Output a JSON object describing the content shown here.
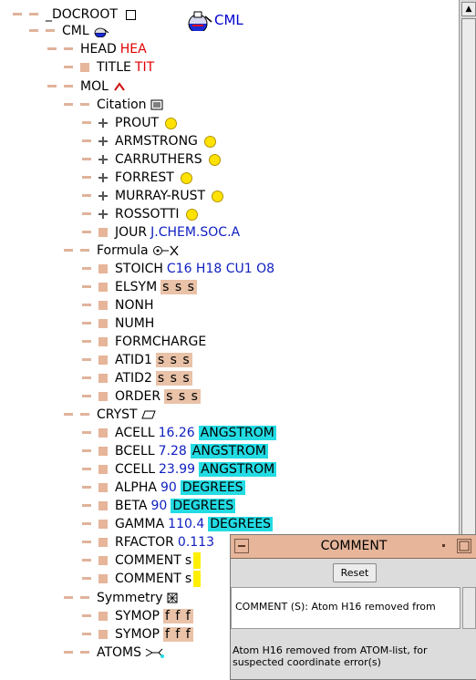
{
  "tree": {
    "root": {
      "name": "_DOCROOT"
    },
    "cml": {
      "name": "CML"
    },
    "head": {
      "name": "HEAD",
      "value": "HEA"
    },
    "title": {
      "name": "TITLE",
      "value": "TIT"
    },
    "mol": {
      "name": "MOL"
    },
    "citation": {
      "name": "Citation"
    },
    "authors": [
      "PROUT",
      "ARMSTRONG",
      "CARRUTHERS",
      "FORREST",
      "MURRAY-RUST",
      "ROSSOTTI"
    ],
    "jour": {
      "name": "JOUR",
      "value": "J.CHEM.SOC.A"
    },
    "formula": {
      "name": "Formula"
    },
    "stoich": {
      "name": "STOICH",
      "value": "C16 H18 CU1 O8"
    },
    "elsym": {
      "name": "ELSYM",
      "value": "s s s"
    },
    "nonh": {
      "name": "NONH"
    },
    "numh": {
      "name": "NUMH"
    },
    "formcharge": {
      "name": "FORMCHARGE"
    },
    "atid1": {
      "name": "ATID1",
      "value": "s s s"
    },
    "atid2": {
      "name": "ATID2",
      "value": "s s s"
    },
    "order": {
      "name": "ORDER",
      "value": "s s s"
    },
    "cryst": {
      "name": "CRYST"
    },
    "cell": [
      {
        "name": "ACELL",
        "value": "16.26",
        "unit": "ANGSTROM"
      },
      {
        "name": "BCELL",
        "value": "7.28",
        "unit": "ANGSTROM"
      },
      {
        "name": "CCELL",
        "value": "23.99",
        "unit": "ANGSTROM"
      },
      {
        "name": "ALPHA",
        "value": "90",
        "unit": "DEGREES"
      },
      {
        "name": "BETA",
        "value": "90",
        "unit": "DEGREES"
      },
      {
        "name": "GAMMA",
        "value": "110.4",
        "unit": "DEGREES"
      }
    ],
    "rfactor": {
      "name": "RFACTOR",
      "value": "0.113"
    },
    "comment1": {
      "name": "COMMENT",
      "value": "s"
    },
    "comment2": {
      "name": "COMMENT",
      "value": "s"
    },
    "symmetry": {
      "name": "Symmetry"
    },
    "symop1": {
      "name": "SYMOP",
      "value": "f f f"
    },
    "symop2": {
      "name": "SYMOP",
      "value": "f f f"
    },
    "atoms": {
      "name": "ATOMS"
    }
  },
  "logo": {
    "label": "CML"
  },
  "comment_window": {
    "title": "COMMENT",
    "reset_label": "Reset",
    "field_text": "COMMENT (S): Atom H16 removed from",
    "body_line1": "Atom H16 removed from ATOM-list, for",
    "body_line2": "suspected coordinate error(s)"
  },
  "colors": {
    "node_peach": "#e6b59a",
    "unit_cyan": "#23dbe3",
    "value_blue": "#1020c0",
    "value_red": "#e00000",
    "marker_yellow": "#ffef00"
  }
}
